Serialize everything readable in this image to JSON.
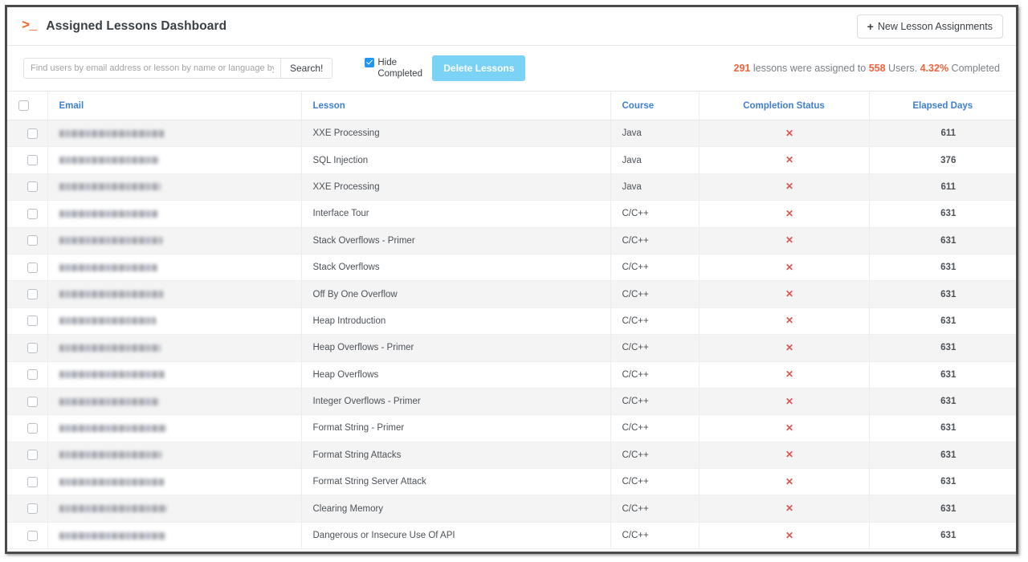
{
  "window": {
    "app_title": "Assigned Lessons Dashboard",
    "prompt_icon": ">_"
  },
  "header": {
    "new_assignments_label": "New Lesson Assignments",
    "plus_glyph": "+"
  },
  "toolbar": {
    "search_placeholder": "Find users by email address or lesson by name or language by name...",
    "search_value": "",
    "search_button_label": "Search!",
    "hide_completed_label": "Hide Completed",
    "hide_completed_checked": true,
    "delete_button_label": "Delete Lessons",
    "stats": {
      "lessons_count": "291",
      "text_1": " lessons were assigned to ",
      "users_count": "558",
      "text_2": " Users. ",
      "completed_percent": "4.32%",
      "text_3": " Completed"
    },
    "accent_color": "#f2623c"
  },
  "table": {
    "columns": [
      {
        "key": "checkbox",
        "label": ""
      },
      {
        "key": "email",
        "label": "Email"
      },
      {
        "key": "lesson",
        "label": "Lesson"
      },
      {
        "key": "course",
        "label": "Course"
      },
      {
        "key": "status",
        "label": "Completion Status"
      },
      {
        "key": "days",
        "label": "Elapsed Days"
      }
    ],
    "status_incomplete_glyph": "✕",
    "status_color": "#d9534f",
    "rows": [
      {
        "email": "[redacted]",
        "email_width": 130,
        "lesson": "XXE Processing",
        "course": "Java",
        "status": "incomplete",
        "days": "611"
      },
      {
        "email": "[redacted]",
        "email_width": 124,
        "lesson": "SQL Injection",
        "course": "Java",
        "status": "incomplete",
        "days": "376"
      },
      {
        "email": "[redacted]",
        "email_width": 126,
        "lesson": "XXE Processing",
        "course": "Java",
        "status": "incomplete",
        "days": "611"
      },
      {
        "email": "[redacted]",
        "email_width": 123,
        "lesson": "Interface Tour",
        "course": "C/C++",
        "status": "incomplete",
        "days": "631"
      },
      {
        "email": "[redacted]",
        "email_width": 128,
        "lesson": "Stack Overflows - Primer",
        "course": "C/C++",
        "status": "incomplete",
        "days": "631"
      },
      {
        "email": "[redacted]",
        "email_width": 122,
        "lesson": "Stack Overflows",
        "course": "C/C++",
        "status": "incomplete",
        "days": "631"
      },
      {
        "email": "[redacted]",
        "email_width": 129,
        "lesson": "Off By One Overflow",
        "course": "C/C++",
        "status": "incomplete",
        "days": "631"
      },
      {
        "email": "[redacted]",
        "email_width": 120,
        "lesson": "Heap Introduction",
        "course": "C/C++",
        "status": "incomplete",
        "days": "631"
      },
      {
        "email": "[redacted]",
        "email_width": 126,
        "lesson": "Heap Overflows - Primer",
        "course": "C/C++",
        "status": "incomplete",
        "days": "631"
      },
      {
        "email": "[redacted]",
        "email_width": 131,
        "lesson": "Heap Overflows",
        "course": "C/C++",
        "status": "incomplete",
        "days": "631"
      },
      {
        "email": "[redacted]",
        "email_width": 124,
        "lesson": "Integer Overflows - Primer",
        "course": "C/C++",
        "status": "incomplete",
        "days": "631"
      },
      {
        "email": "[redacted]",
        "email_width": 133,
        "lesson": "Format String - Primer",
        "course": "C/C++",
        "status": "incomplete",
        "days": "631"
      },
      {
        "email": "[redacted]",
        "email_width": 127,
        "lesson": "Format String Attacks",
        "course": "C/C++",
        "status": "incomplete",
        "days": "631"
      },
      {
        "email": "[redacted]",
        "email_width": 130,
        "lesson": "Format String Server Attack",
        "course": "C/C++",
        "status": "incomplete",
        "days": "631"
      },
      {
        "email": "[redacted]",
        "email_width": 134,
        "lesson": "Clearing Memory",
        "course": "C/C++",
        "status": "incomplete",
        "days": "631"
      },
      {
        "email": "[redacted]",
        "email_width": 132,
        "lesson": "Dangerous or Insecure Use Of API",
        "course": "C/C++",
        "status": "incomplete",
        "days": "631"
      }
    ]
  }
}
